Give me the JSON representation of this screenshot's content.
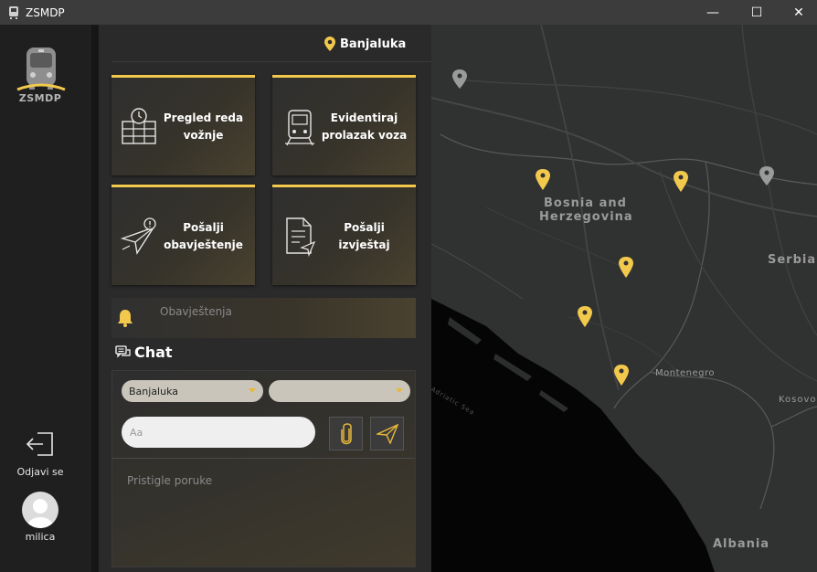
{
  "window": {
    "title": "ZSMDP",
    "minimize": "—",
    "maximize": "☐",
    "close": "✕"
  },
  "sidebar": {
    "logo_text": "ZSMDP",
    "logout_label": "Odjavi se",
    "user_name": "milica"
  },
  "header": {
    "location": "Banjaluka"
  },
  "tiles": [
    {
      "label": "Pregled reda\nvožnje",
      "icon": "timetable-icon"
    },
    {
      "label": "Evidentiraj\nprolazak voza",
      "icon": "train-icon"
    },
    {
      "label": "Pošalji\nobavještenje",
      "icon": "send-notification-icon"
    },
    {
      "label": "Pošalji\nizvještaj",
      "icon": "report-icon"
    }
  ],
  "notifications": {
    "label": "Obavještenja"
  },
  "chat": {
    "title": "Chat",
    "station_select": "Banjaluka",
    "second_select": "",
    "message_placeholder": "Aa",
    "incoming_label": "Pristigle poruke"
  },
  "map": {
    "labels": {
      "bosnia_line1": "Bosnia and",
      "bosnia_line2": "Herzegovina",
      "serbia": "Serbia",
      "montenegro": "Montenegro",
      "kosovo": "Kosovo",
      "albania": "Albania",
      "adriatic": "Adriatic Sea"
    },
    "marker_color": "#f2c94c",
    "inactive_marker_color": "#9a9a9a"
  }
}
